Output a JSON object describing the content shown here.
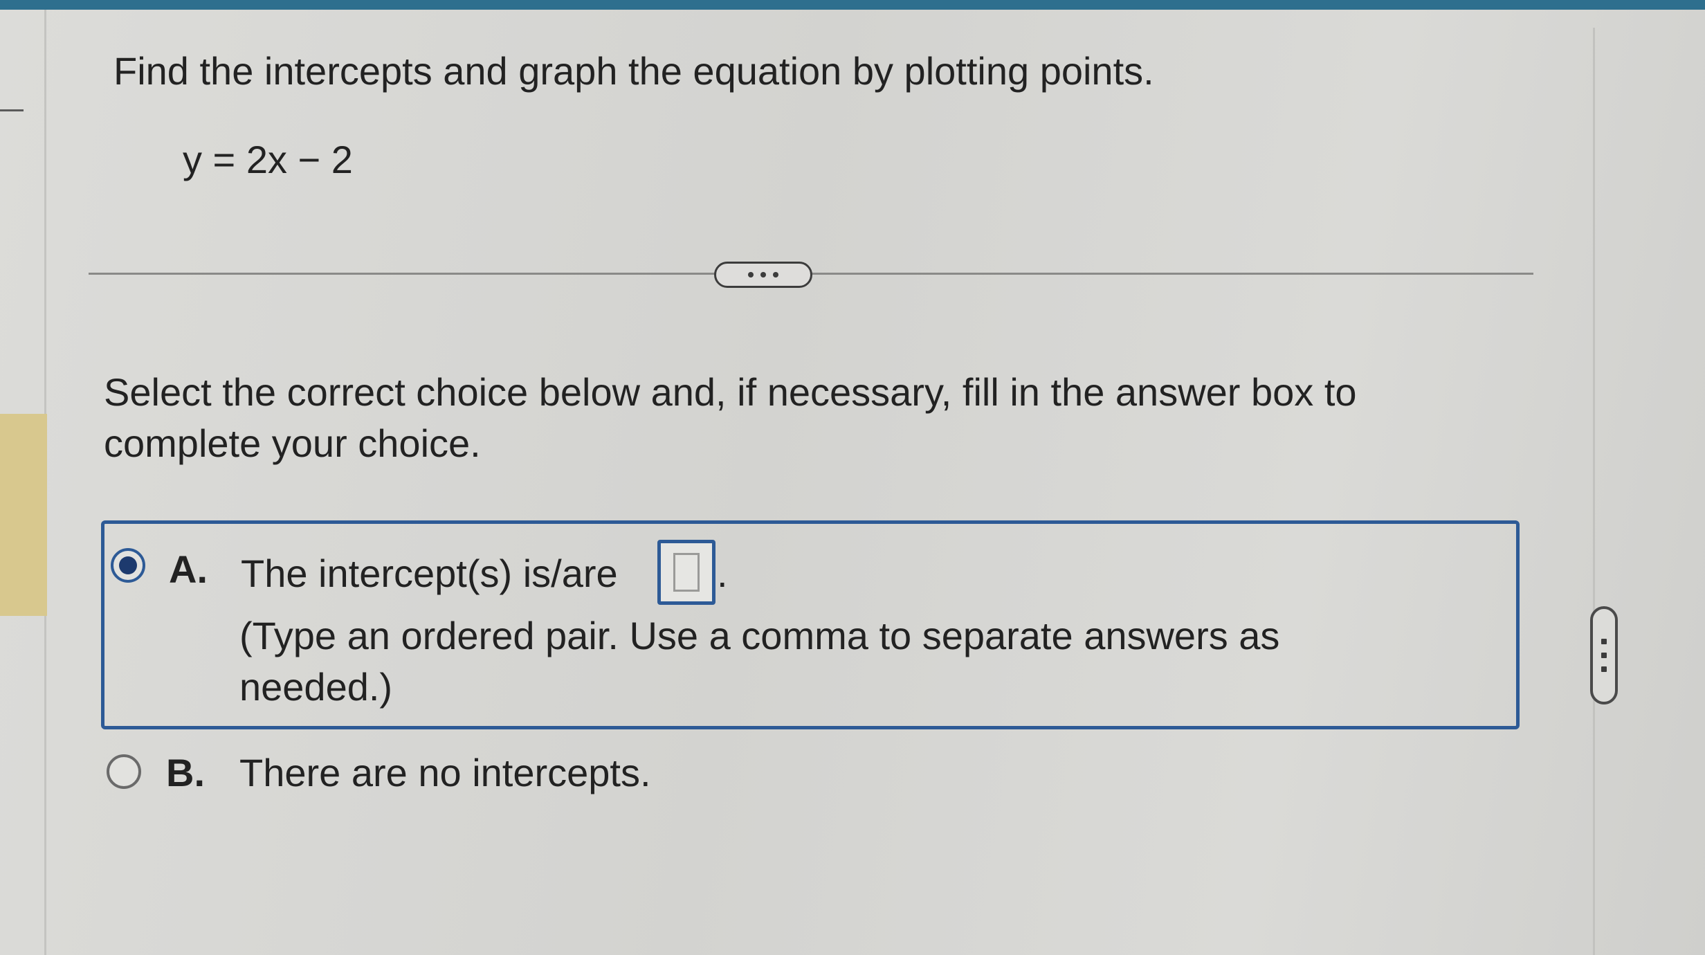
{
  "problem": {
    "instruction": "Find the intercepts and graph the equation by plotting points.",
    "equation": "y = 2x − 2"
  },
  "answer_prompt": "Select the correct choice below and, if necessary, fill in the answer box to complete your choice.",
  "choices": [
    {
      "letter": "A.",
      "text": "The intercept(s) is/are",
      "trailing": ".",
      "hint": "(Type an ordered pair. Use a comma to separate answers as needed.)",
      "selected": true,
      "answer_value": ""
    },
    {
      "letter": "B.",
      "text": "There are no intercepts.",
      "selected": false
    }
  ],
  "colors": {
    "accent": "#2d5a96",
    "top_bar": "#2e6f8e",
    "side_highlight": "#d8c88e"
  }
}
